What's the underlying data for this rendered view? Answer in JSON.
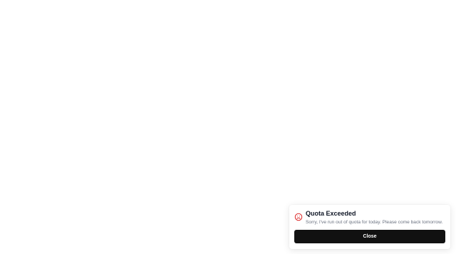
{
  "toast": {
    "icon": "sad-face-icon",
    "icon_color": "#dc2626",
    "title": "Quota Exceeded",
    "message": "Sorry, I've run out of quota for today. Please come back tomorrow.",
    "close_label": "Close",
    "button_color": "#111111"
  }
}
